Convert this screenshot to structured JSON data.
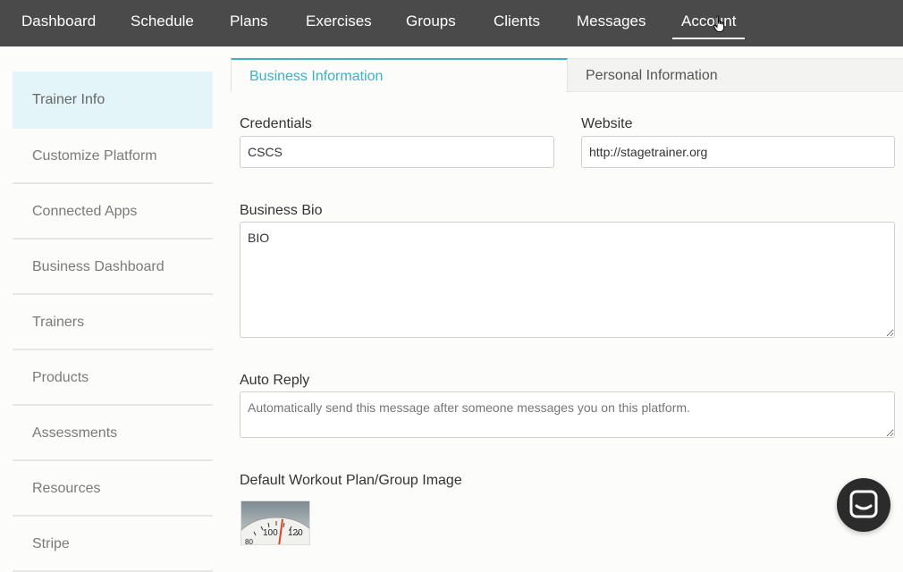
{
  "nav": {
    "items": [
      {
        "label": "Dashboard"
      },
      {
        "label": "Schedule"
      },
      {
        "label": "Plans"
      },
      {
        "label": "Exercises"
      },
      {
        "label": "Groups"
      },
      {
        "label": "Clients"
      },
      {
        "label": "Messages"
      },
      {
        "label": "Account"
      }
    ],
    "active": "Account"
  },
  "sidebar": {
    "items": [
      {
        "label": "Trainer Info"
      },
      {
        "label": "Customize Platform"
      },
      {
        "label": "Connected Apps"
      },
      {
        "label": "Business Dashboard"
      },
      {
        "label": "Trainers"
      },
      {
        "label": "Products"
      },
      {
        "label": "Assessments"
      },
      {
        "label": "Resources"
      },
      {
        "label": "Stripe"
      }
    ],
    "active": "Trainer Info"
  },
  "tabs": {
    "business": "Business Information",
    "personal": "Personal Information"
  },
  "form": {
    "credentials_label": "Credentials",
    "credentials_value": "CSCS",
    "website_label": "Website",
    "website_value": "http://stagetrainer.org",
    "bio_label": "Business Bio",
    "bio_value": "BIO",
    "auto_reply_label": "Auto Reply",
    "auto_reply_placeholder": "Automatically send this message after someone messages you on this platform.",
    "image_label": "Default Workout Plan/Group Image",
    "scale_numbers": [
      "100",
      "120",
      "80"
    ]
  },
  "colors": {
    "nav_bg": "#4a4a4a",
    "accent": "#3bb0c9",
    "sidebar_active_bg": "#e3f5f8",
    "chat_bg": "#2b2b2b"
  },
  "icons": {
    "chat": "chat-bubble-icon",
    "cursor": "hand-cursor-icon"
  }
}
